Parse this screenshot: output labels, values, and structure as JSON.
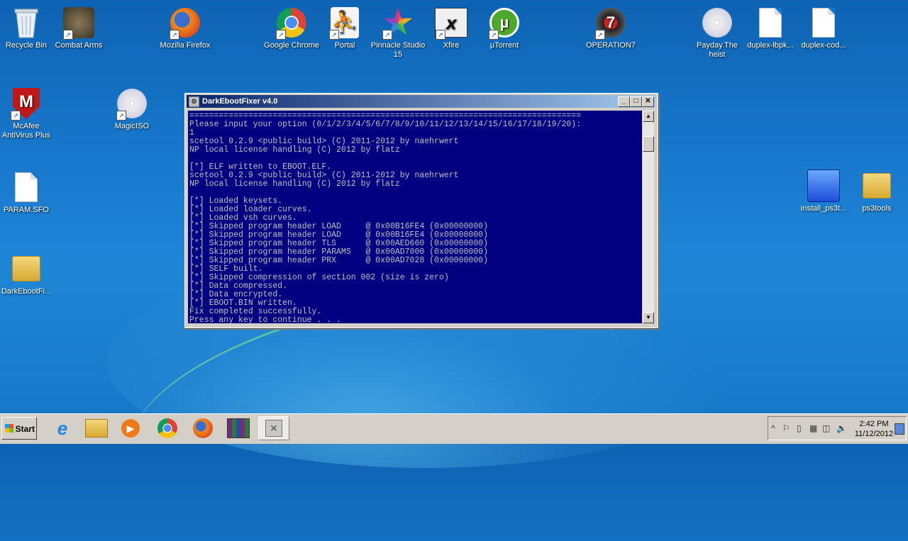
{
  "desktop_icons": [
    {
      "label": "Recycle Bin",
      "icon": "recycle-bin-icon"
    },
    {
      "label": "Combat Arms",
      "icon": "combat-arms-icon"
    },
    {
      "label": "Mozilla Firefox",
      "icon": "firefox-icon"
    },
    {
      "label": "Google Chrome",
      "icon": "chrome-icon"
    },
    {
      "label": "Portal",
      "icon": "portal-icon"
    },
    {
      "label": "Pinnacle Studio 15",
      "icon": "pinnacle-icon"
    },
    {
      "label": "Xfire",
      "icon": "xfire-icon"
    },
    {
      "label": "µTorrent",
      "icon": "utorrent-icon"
    },
    {
      "label": "OPERATION7",
      "icon": "operation7-icon"
    },
    {
      "label": "Payday.The heist",
      "icon": "disc-icon"
    },
    {
      "label": "duplex-lbpk...",
      "icon": "file-icon"
    },
    {
      "label": "duplex-cod...",
      "icon": "file-icon"
    },
    {
      "label": "McAfee AntiVirus Plus",
      "icon": "mcafee-icon"
    },
    {
      "label": "MagicISO",
      "icon": "disc-icon"
    },
    {
      "label": "PARAM.SFO",
      "icon": "file-icon"
    },
    {
      "label": "install_ps3t...",
      "icon": "installer-icon"
    },
    {
      "label": "ps3tools",
      "icon": "folder-icon"
    },
    {
      "label": "DarkEbootFi...",
      "icon": "folder-icon"
    }
  ],
  "window": {
    "title": "DarkEbootFixer v4.0",
    "minimize": "_",
    "maximize": "□",
    "close": "✕",
    "console_lines": [
      "================================================================================",
      "Please input your option (0/1/2/3/4/5/6/7/8/9/10/11/12/13/14/15/16/17/18/19/20):",
      "1",
      "scetool 0.2.9 <public build> (C) 2011-2012 by naehrwert",
      "NP local license handling (C) 2012 by flatz",
      "",
      "[*] ELF written to EBOOT.ELF.",
      "scetool 0.2.9 <public build> (C) 2011-2012 by naehrwert",
      "NP local license handling (C) 2012 by flatz",
      "",
      "[*] Loaded keysets.",
      "[*] Loaded loader curves.",
      "[*] Loaded vsh curves.",
      "[*] Skipped program header LOAD     @ 0x00B16FE4 (0x00000000)",
      "[*] Skipped program header LOAD     @ 0x00B16FE4 (0x00000000)",
      "[*] Skipped program header TLS      @ 0x00AED660 (0x00000000)",
      "[*] Skipped program header PARAMS   @ 0x00AD7000 (0x00000000)",
      "[*] Skipped program header PRX      @ 0x00AD7028 (0x00000000)",
      "[*] SELF built.",
      "[*] Skipped compression of section 002 (size is zero)",
      "[*] Data compressed.",
      "[*] Data encrypted.",
      "[*] EBOOT.BIN written.",
      "Fix completed successfully.",
      "Press any key to continue . . ."
    ]
  },
  "taskbar": {
    "start_label": "Start",
    "pinned": [
      {
        "icon": "internet-explorer-icon"
      },
      {
        "icon": "file-explorer-icon"
      },
      {
        "icon": "media-player-icon"
      },
      {
        "icon": "chrome-icon"
      },
      {
        "icon": "firefox-icon"
      },
      {
        "icon": "winrar-icon"
      },
      {
        "icon": "darkebootfixer-icon"
      }
    ],
    "clock_time": "2:42 PM",
    "clock_date": "11/12/2012"
  }
}
